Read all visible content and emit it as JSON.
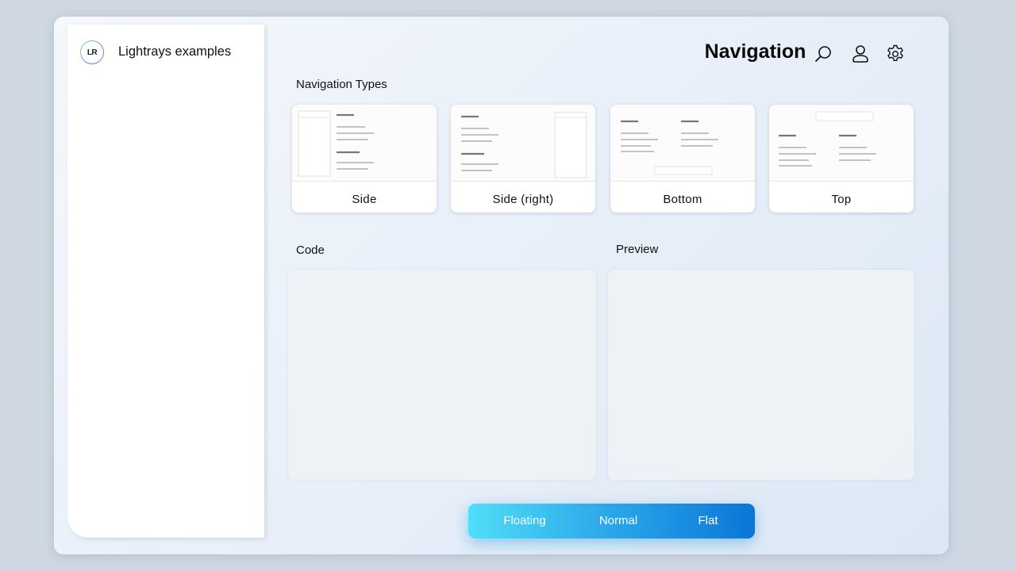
{
  "app": {
    "logo_text": "LR",
    "title": "Lightrays examples"
  },
  "header": {
    "title": "Navigation",
    "icons": [
      "search-icon",
      "user-icon",
      "gear-icon"
    ]
  },
  "navigation_types": {
    "label": "Navigation Types",
    "cards": [
      {
        "label": "Side"
      },
      {
        "label": "Side (right)"
      },
      {
        "label": "Bottom"
      },
      {
        "label": "Top"
      }
    ]
  },
  "code": {
    "label": "Code"
  },
  "preview": {
    "label": "Preview"
  },
  "style_switcher": {
    "options": [
      "Floating",
      "Normal",
      "Flat"
    ]
  }
}
